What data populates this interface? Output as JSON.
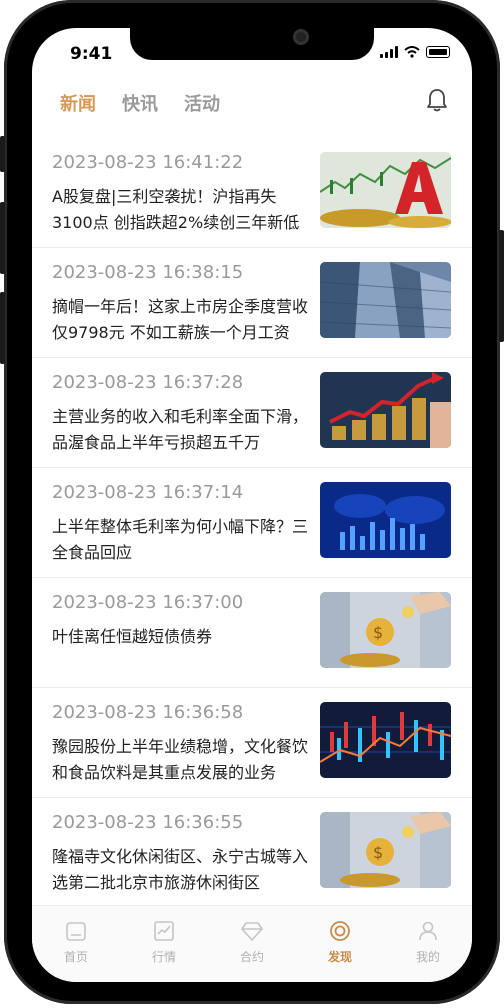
{
  "status_bar": {
    "time": "9:41"
  },
  "header": {
    "tabs": [
      {
        "label": "新闻",
        "active": true
      },
      {
        "label": "快讯",
        "active": false
      },
      {
        "label": "活动",
        "active": false
      }
    ],
    "notification_icon": "bell-icon"
  },
  "news": [
    {
      "time": "2023-08-23 16:41:22",
      "title": "A股复盘|三利空袭扰！沪指再失3100点 创指跌超2%续创三年新低",
      "thumb": "stock-chart-red-a-coins"
    },
    {
      "time": "2023-08-23 16:38:15",
      "title": "摘帽一年后！这家上市房企季度营收仅9798元 不如工薪族一个月工资",
      "thumb": "skyscrapers"
    },
    {
      "time": "2023-08-23 16:37:28",
      "title": "主营业务的收入和毛利率全面下滑，品渥食品上半年亏损超五千万",
      "thumb": "coin-stacks-growth-arrow"
    },
    {
      "time": "2023-08-23 16:37:14",
      "title": "上半年整体毛利率为何小幅下降？三全食品回应",
      "thumb": "blue-world-map-bars"
    },
    {
      "time": "2023-08-23 16:37:00",
      "title": "叶佳离任恒越短债债券",
      "thumb": "gold-coins-hand"
    },
    {
      "time": "2023-08-23 16:36:58",
      "title": "豫园股份上半年业绩稳增，文化餐饮和食品饮料是其重点发展的业务",
      "thumb": "candlestick-chart-dark"
    },
    {
      "time": "2023-08-23 16:36:55",
      "title": "隆福寺文化休闲街区、永宁古城等入选第二批北京市旅游休闲街区",
      "thumb": "gold-coins-hand"
    }
  ],
  "tabbar": [
    {
      "label": "首页",
      "icon": "home-icon",
      "active": false
    },
    {
      "label": "行情",
      "icon": "market-chart-icon",
      "active": false
    },
    {
      "label": "合约",
      "icon": "diamond-icon",
      "active": false
    },
    {
      "label": "发现",
      "icon": "discover-icon",
      "active": true
    },
    {
      "label": "我的",
      "icon": "profile-icon",
      "active": false
    }
  ],
  "colors": {
    "accent": "#d49a5a",
    "inactive": "#9a9a9a",
    "title": "#222222"
  }
}
